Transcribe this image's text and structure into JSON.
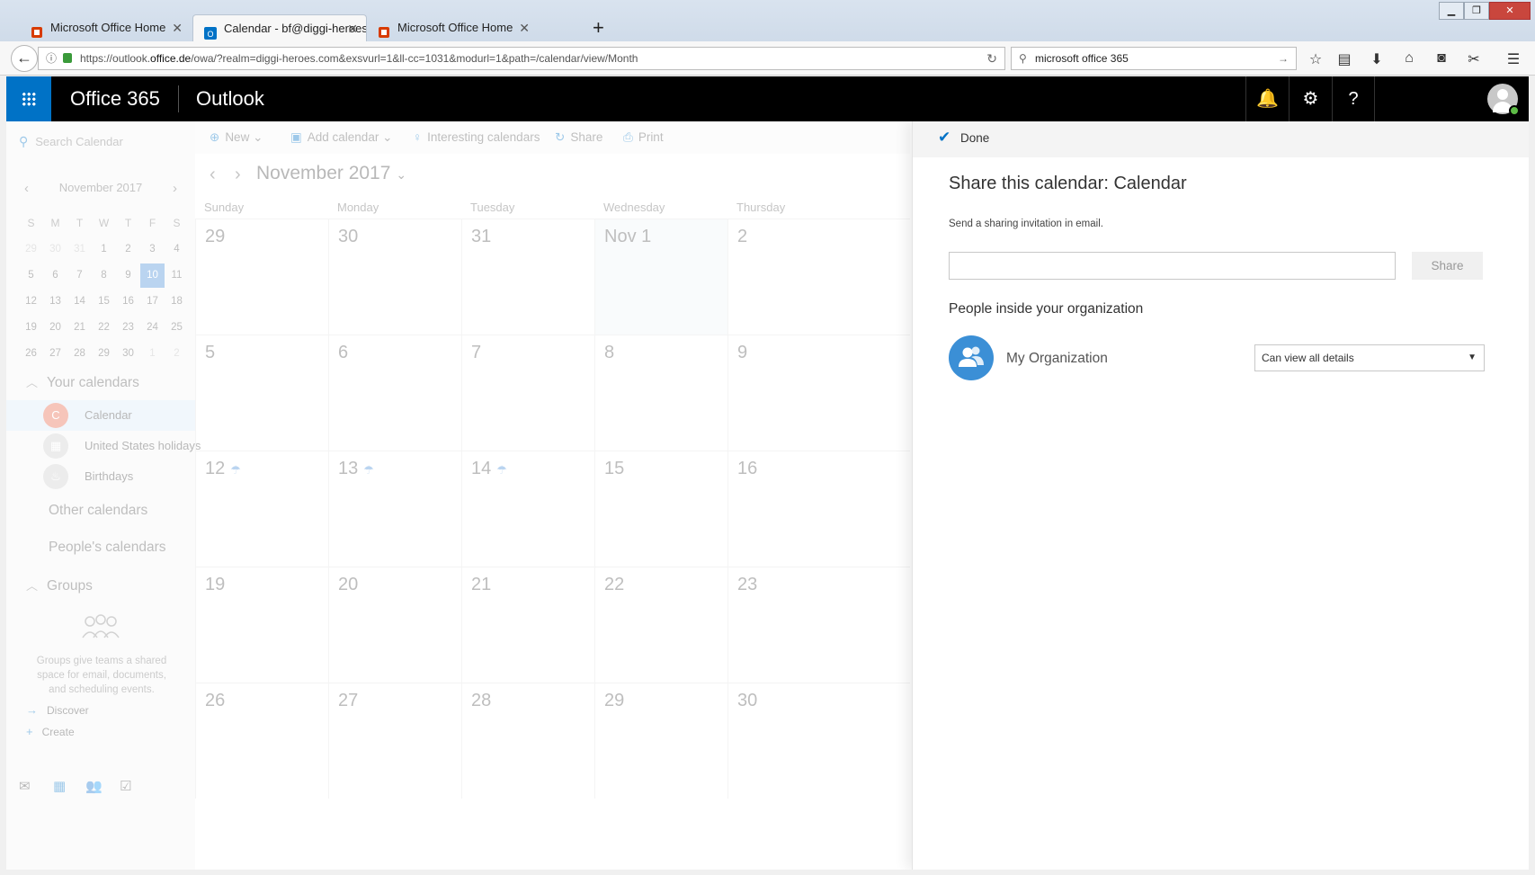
{
  "browser": {
    "tabs": [
      {
        "title": "Microsoft Office Home",
        "icon": "office-icon",
        "color": "#d83b01"
      },
      {
        "title": "Calendar - bf@diggi-heroes...",
        "icon": "outlook-icon",
        "color": "#0072c6"
      },
      {
        "title": "Microsoft Office Home",
        "icon": "office-icon",
        "color": "#d83b01"
      }
    ],
    "url_prefix": "https://outlook.",
    "url_domain": "office.de",
    "url_path": "/owa/?realm=diggi-heroes.com&exsvurl=1&ll-cc=1031&modurl=1&path=/calendar/view/Month",
    "search_value": "microsoft office 365"
  },
  "header": {
    "suite": "Office 365",
    "app": "Outlook",
    "accent": "#0072c6"
  },
  "left": {
    "search_placeholder": "Search Calendar",
    "mini_month": "November 2017",
    "dow": [
      "S",
      "M",
      "T",
      "W",
      "T",
      "F",
      "S"
    ],
    "weeks": [
      [
        "29",
        "30",
        "31",
        "1",
        "2",
        "3",
        "4"
      ],
      [
        "5",
        "6",
        "7",
        "8",
        "9",
        "10",
        "11"
      ],
      [
        "12",
        "13",
        "14",
        "15",
        "16",
        "17",
        "18"
      ],
      [
        "19",
        "20",
        "21",
        "22",
        "23",
        "24",
        "25"
      ],
      [
        "26",
        "27",
        "28",
        "29",
        "30",
        "1",
        "2"
      ]
    ],
    "today": "10",
    "your_calendars": "Your calendars",
    "calendars": [
      {
        "name": "Calendar",
        "initial": "C"
      },
      {
        "name": "United States holidays"
      },
      {
        "name": "Birthdays"
      }
    ],
    "other_calendars": "Other calendars",
    "peoples_calendars": "People's calendars",
    "groups": "Groups",
    "groups_text": "Groups give teams a shared space for email, documents, and scheduling events.",
    "discover": "Discover",
    "create": "Create"
  },
  "toolbar": {
    "new": "New",
    "add_calendar": "Add calendar",
    "interesting": "Interesting calendars",
    "share": "Share",
    "print": "Print"
  },
  "month": {
    "title": "November 2017",
    "days": [
      "Sunday",
      "Monday",
      "Tuesday",
      "Wednesday",
      "Thursday"
    ],
    "weeks": [
      [
        "29",
        "30",
        "31",
        "Nov 1",
        "2"
      ],
      [
        "5",
        "6",
        "7",
        "8",
        "9"
      ],
      [
        "12",
        "13",
        "14",
        "15",
        "16"
      ],
      [
        "19",
        "20",
        "21",
        "22",
        "23"
      ],
      [
        "26",
        "27",
        "28",
        "29",
        "30"
      ]
    ]
  },
  "share": {
    "done": "Done",
    "title": "Share this calendar: Calendar",
    "hint": "Send a sharing invitation in email.",
    "button": "Share",
    "section": "People inside your organization",
    "org": "My Organization",
    "permission": "Can view all details"
  }
}
